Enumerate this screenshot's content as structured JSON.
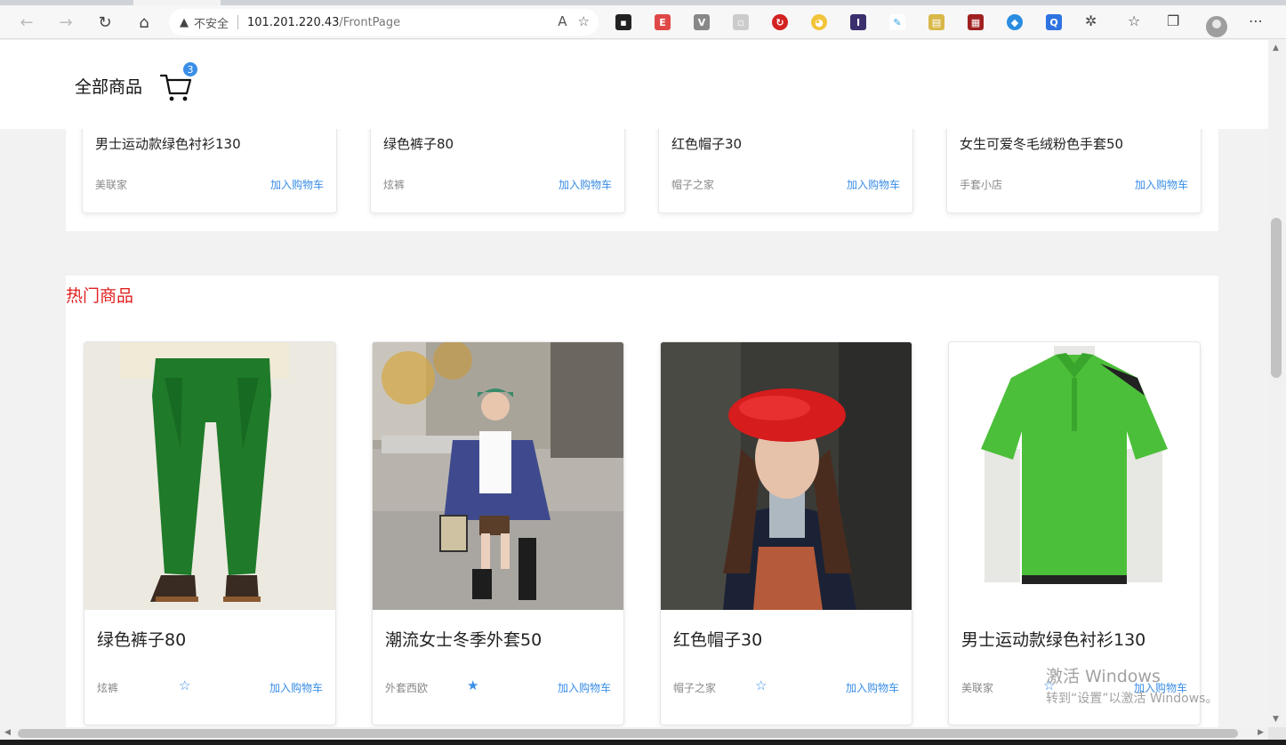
{
  "browser": {
    "security_label": "不安全",
    "url_host": "101.201.220.43",
    "url_path": "/FrontPage"
  },
  "header": {
    "title": "全部商品",
    "cart_count": "3"
  },
  "top_products": [
    {
      "name": "男士运动款绿色衬衫130",
      "shop": "美联家",
      "add_label": "加入购物车"
    },
    {
      "name": "绿色裤子80",
      "shop": "炫裤",
      "add_label": "加入购物车"
    },
    {
      "name": "红色帽子30",
      "shop": "帽子之家",
      "add_label": "加入购物车"
    },
    {
      "name": "女生可爱冬毛绒粉色手套50",
      "shop": "手套小店",
      "add_label": "加入购物车"
    }
  ],
  "hot": {
    "title": "热门商品",
    "products": [
      {
        "name": "绿色裤子80",
        "shop": "炫裤",
        "star": "☆",
        "add_label": "加入购物车",
        "image": "green-pants-photo"
      },
      {
        "name": "潮流女士冬季外套50",
        "shop": "外套西欧",
        "star": "★",
        "add_label": "加入购物车",
        "image": "winter-jacket-photo"
      },
      {
        "name": "红色帽子30",
        "shop": "帽子之家",
        "star": "☆",
        "add_label": "加入购物车",
        "image": "red-beret-photo"
      },
      {
        "name": "男士运动款绿色衬衫130",
        "shop": "美联家",
        "star": "☆",
        "add_label": "加入购物车",
        "image": "green-polo-photo"
      }
    ]
  },
  "watermark": {
    "line1": "激活 Windows",
    "line2": "转到“设置”以激活 Windows。"
  },
  "colors": {
    "accent": "#3a8ee6",
    "hot_title": "#e02020"
  }
}
